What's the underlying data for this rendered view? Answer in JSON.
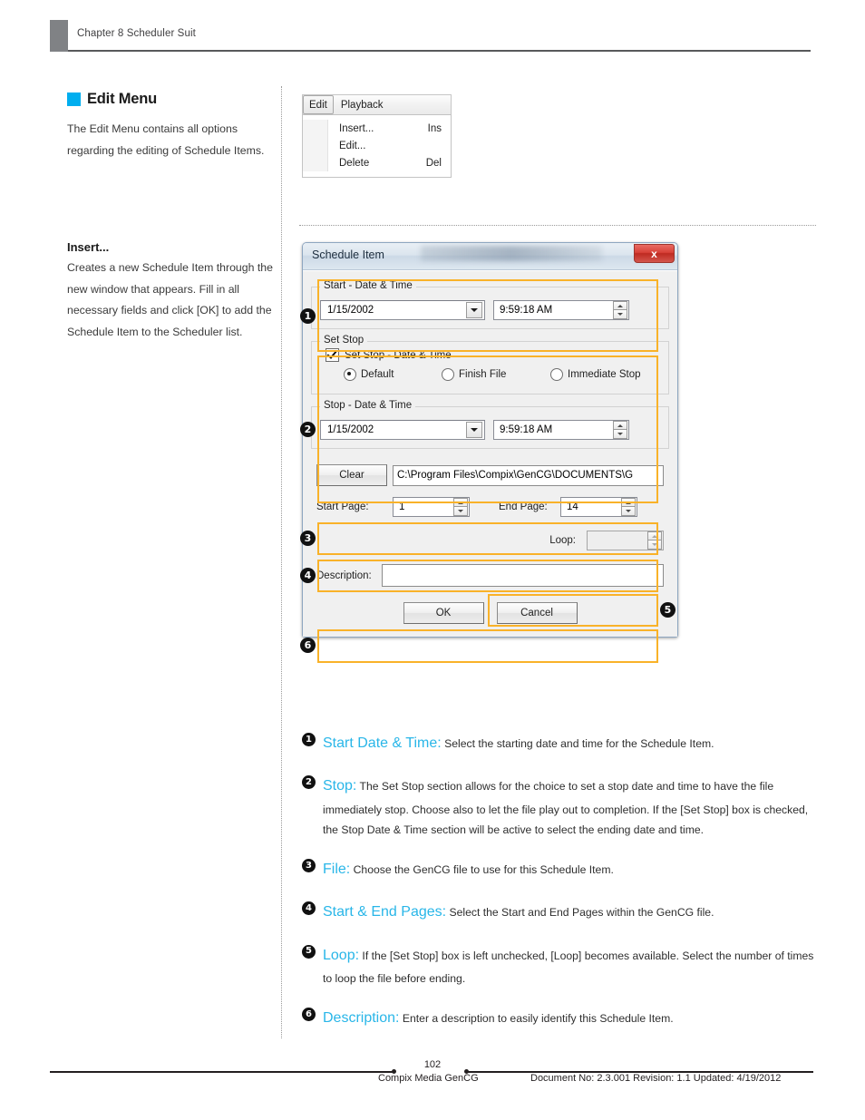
{
  "header": {
    "chapter": "Chapter 8 Scheduler Suit"
  },
  "left_column": {
    "section_title": "Edit Menu",
    "section_swatch_color": "#00aeef",
    "section_body": "The Edit Menu contains all options regarding the editing of Schedule Items.",
    "sub_title": "Insert...",
    "sub_body": "Creates a new Schedule Item through the new window that appears. Fill in all necessary fields and click [OK] to add the Schedule Item to the Scheduler list."
  },
  "edit_menu": {
    "menubar": [
      {
        "label": "Edit",
        "active": true
      },
      {
        "label": "Playback",
        "active": false
      }
    ],
    "items": [
      {
        "label": "Insert...",
        "accel": "Ins"
      },
      {
        "label": "Edit...",
        "accel": ""
      },
      {
        "label": "Delete",
        "accel": "Del"
      }
    ]
  },
  "dialog": {
    "title": "Schedule Item",
    "close_glyph": "x",
    "start_group": {
      "legend": "Start - Date & Time",
      "date": "1/15/2002",
      "time": "9:59:18 AM"
    },
    "set_stop_group": {
      "legend": "Set Stop",
      "checkbox_label": "Set Stop - Date & Time",
      "checkbox_checked": true,
      "radios": [
        {
          "label": "Default",
          "selected": true
        },
        {
          "label": "Finish File",
          "selected": false
        },
        {
          "label": "Immediate Stop",
          "selected": false
        }
      ]
    },
    "stop_group": {
      "legend": "Stop - Date & Time",
      "date": "1/15/2002",
      "time": "9:59:18 AM"
    },
    "file_row": {
      "clear_button": "Clear",
      "path": "C:\\Program Files\\Compix\\GenCG\\DOCUMENTS\\G"
    },
    "pages_row": {
      "start_label": "Start Page:",
      "start_value": "1",
      "end_label": "End Page:",
      "end_value": "14"
    },
    "loop_row": {
      "label": "Loop:",
      "value": "",
      "disabled": true
    },
    "description_row": {
      "label": "Description:",
      "value": ""
    },
    "buttons": {
      "ok": "OK",
      "cancel": "Cancel"
    },
    "callouts": [
      "1",
      "2",
      "3",
      "4",
      "5",
      "6"
    ],
    "highlight_color": "#f9b229"
  },
  "legend": {
    "accent_color": "#29b6e8",
    "items": [
      {
        "num": "1",
        "term": "Start Date & Time:",
        "text": " Select the starting date and time for the Schedule Item."
      },
      {
        "num": "2",
        "term": "Stop:",
        "text": " The Set Stop section allows for the choice to set a stop date and time to have the file immediately stop. Choose also to let the file play out to completion. If the [Set Stop] box is checked, the Stop Date & Time section will be active to select the ending date and time."
      },
      {
        "num": "3",
        "term": "File:",
        "text": " Choose the GenCG file to use for this Schedule Item."
      },
      {
        "num": "4",
        "term": "Start & End Pages:",
        "text": " Select the Start and End Pages within the GenCG file."
      },
      {
        "num": "5",
        "term": "Loop:",
        "text": " If the [Set Stop] box is left unchecked, [Loop] becomes available. Select the number of times to loop the file before ending."
      },
      {
        "num": "6",
        "term": "Description:",
        "text": " Enter a description to easily identify this Schedule Item."
      }
    ]
  },
  "footer": {
    "page_number": "102",
    "left_text": "Compix Media GenCG",
    "right_text": "Document No: 2.3.001 Revision: 1.1 Updated: 4/19/2012"
  }
}
